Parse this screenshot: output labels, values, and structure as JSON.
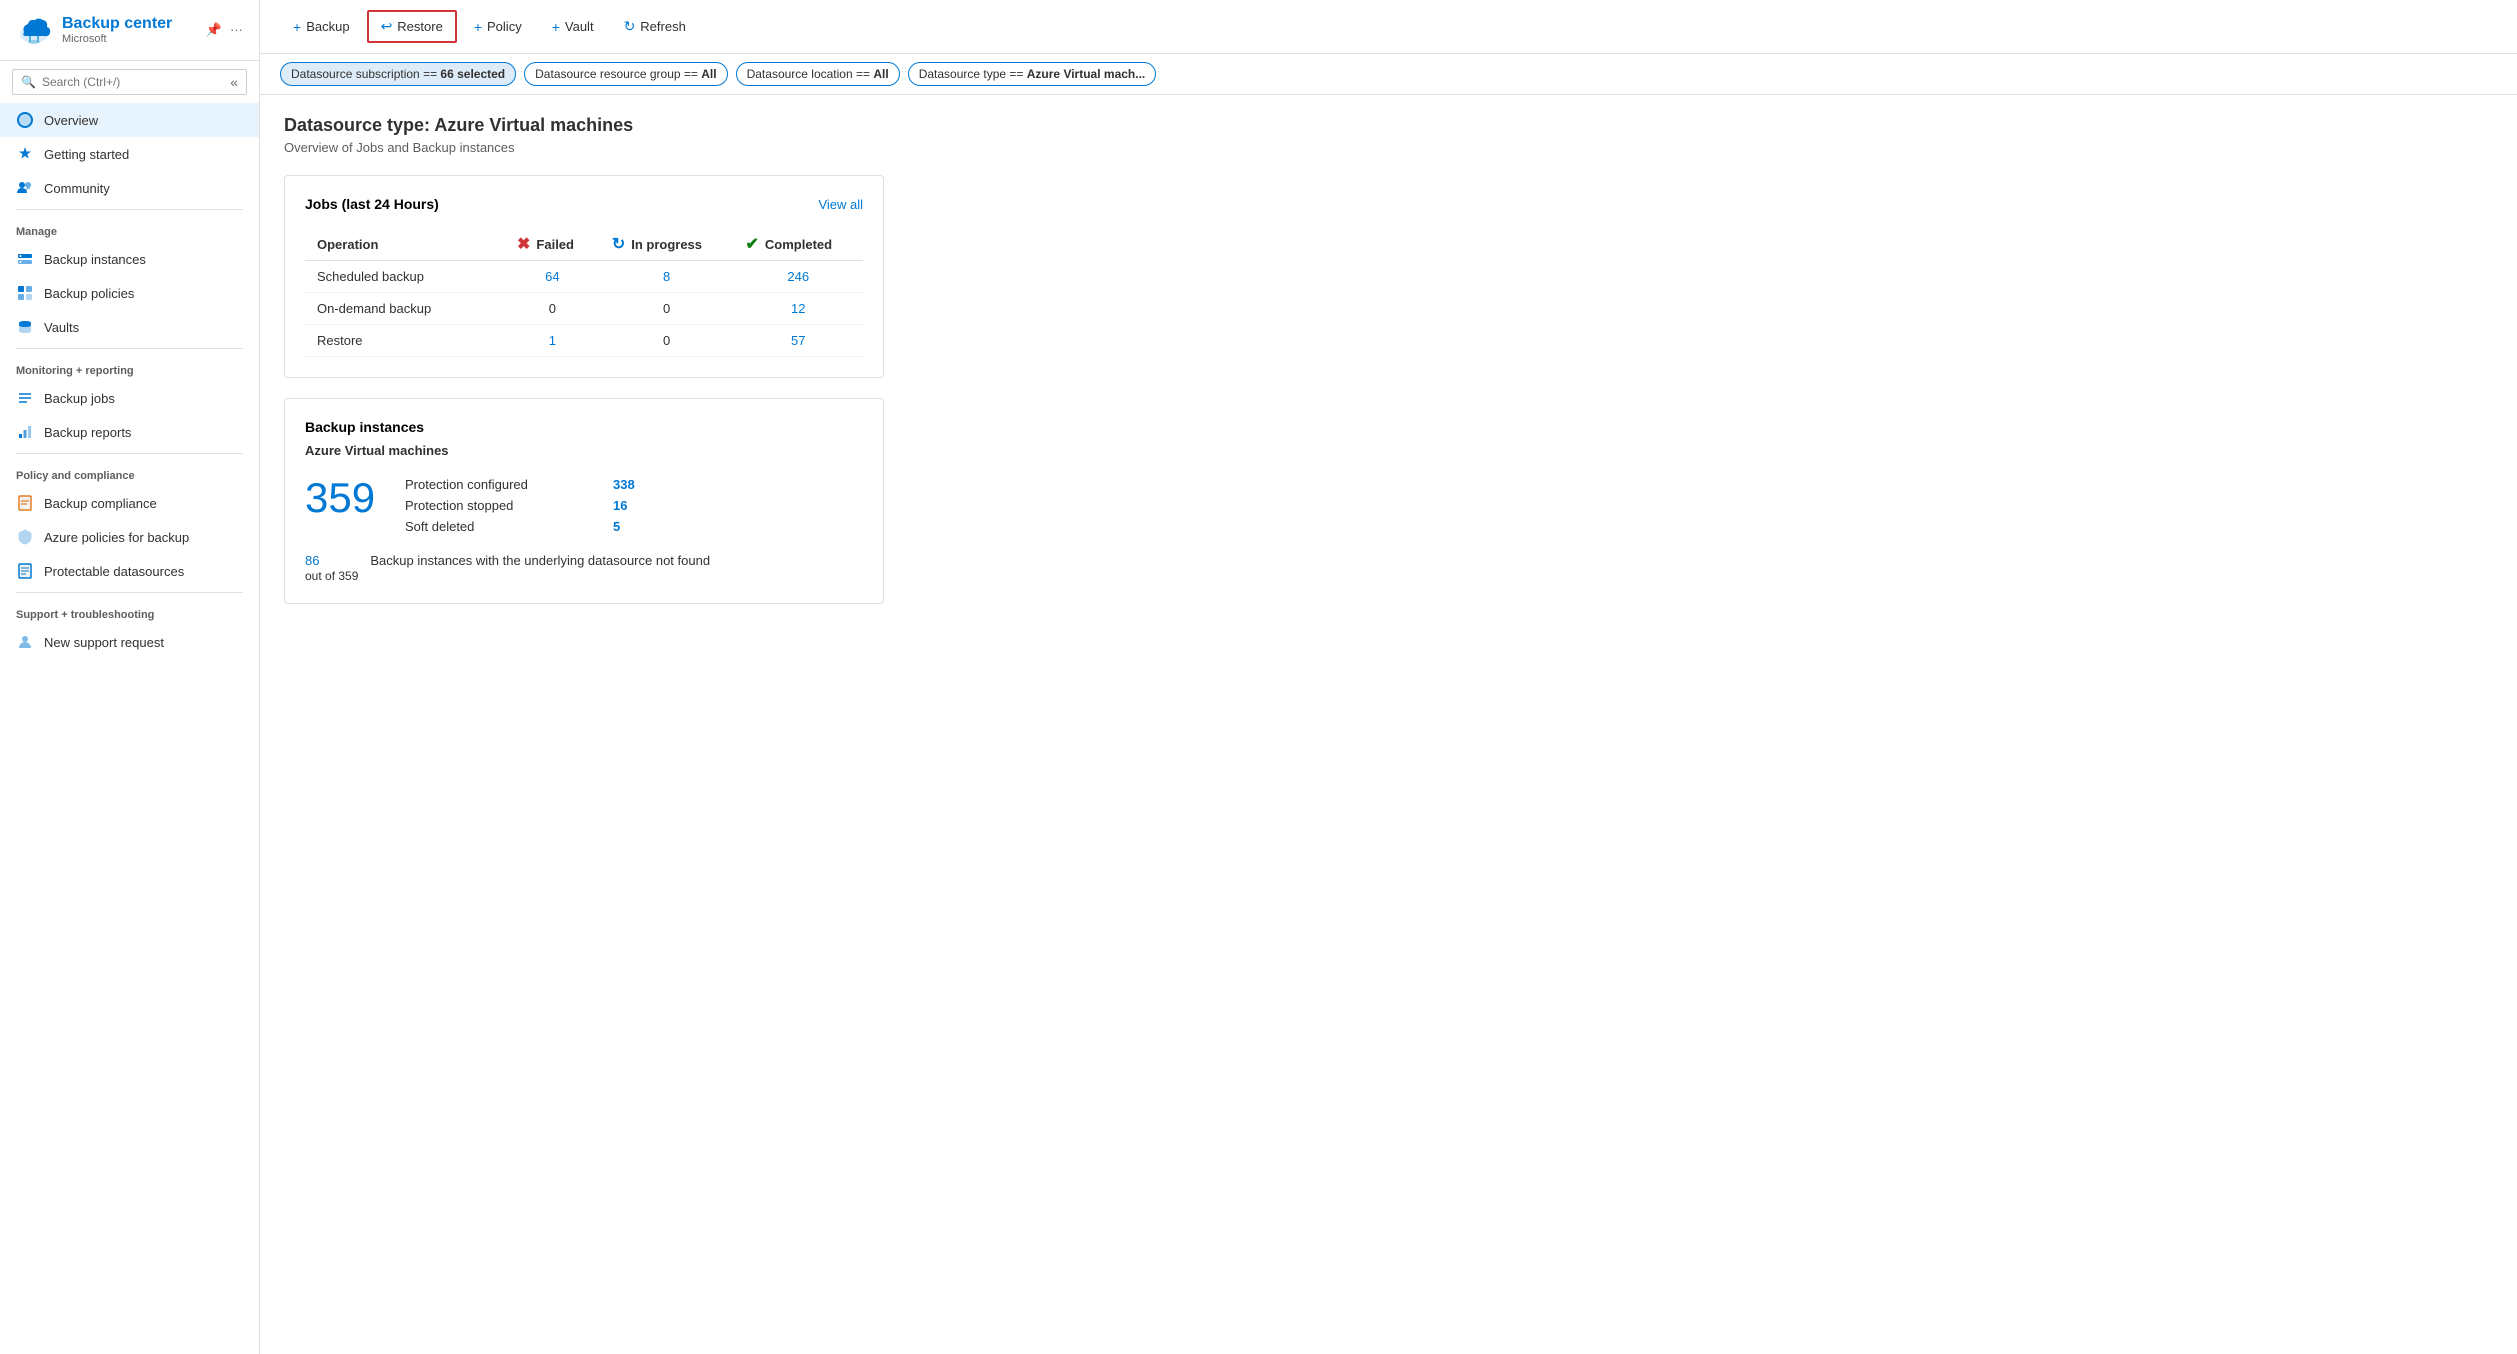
{
  "app": {
    "title": "Backup center",
    "subtitle": "Microsoft"
  },
  "sidebar": {
    "search_placeholder": "Search (Ctrl+/)",
    "nav_items": [
      {
        "id": "overview",
        "label": "Overview",
        "active": true,
        "icon": "cloud"
      },
      {
        "id": "getting-started",
        "label": "Getting started",
        "active": false,
        "icon": "rocket"
      },
      {
        "id": "community",
        "label": "Community",
        "active": false,
        "icon": "people"
      }
    ],
    "sections": [
      {
        "id": "manage",
        "label": "Manage",
        "items": [
          {
            "id": "backup-instances",
            "label": "Backup instances",
            "icon": "database"
          },
          {
            "id": "backup-policies",
            "label": "Backup policies",
            "icon": "grid"
          },
          {
            "id": "vaults",
            "label": "Vaults",
            "icon": "cloud-storage"
          }
        ]
      },
      {
        "id": "monitoring",
        "label": "Monitoring + reporting",
        "items": [
          {
            "id": "backup-jobs",
            "label": "Backup jobs",
            "icon": "list"
          },
          {
            "id": "backup-reports",
            "label": "Backup reports",
            "icon": "chart"
          }
        ]
      },
      {
        "id": "policy",
        "label": "Policy and compliance",
        "items": [
          {
            "id": "backup-compliance",
            "label": "Backup compliance",
            "icon": "doc-check"
          },
          {
            "id": "azure-policies",
            "label": "Azure policies for backup",
            "icon": "shield"
          },
          {
            "id": "protectable",
            "label": "Protectable datasources",
            "icon": "doc-list"
          }
        ]
      },
      {
        "id": "support",
        "label": "Support + troubleshooting",
        "items": [
          {
            "id": "new-support",
            "label": "New support request",
            "icon": "person"
          }
        ]
      }
    ]
  },
  "toolbar": {
    "buttons": [
      {
        "id": "backup",
        "label": "Backup",
        "icon": "+",
        "highlighted": false
      },
      {
        "id": "restore",
        "label": "Restore",
        "icon": "↩",
        "highlighted": true
      },
      {
        "id": "policy",
        "label": "Policy",
        "icon": "+",
        "highlighted": false
      },
      {
        "id": "vault",
        "label": "Vault",
        "icon": "+",
        "highlighted": false
      },
      {
        "id": "refresh",
        "label": "Refresh",
        "icon": "↻",
        "highlighted": false
      }
    ]
  },
  "filters": [
    {
      "id": "subscription",
      "label": "Datasource subscription == ",
      "bold": "66 selected",
      "selected": true
    },
    {
      "id": "resource-group",
      "label": "Datasource resource group == ",
      "bold": "All",
      "selected": false
    },
    {
      "id": "location",
      "label": "Datasource location == ",
      "bold": "All",
      "selected": false
    },
    {
      "id": "type",
      "label": "Datasource type == ",
      "bold": "Azure Virtual mach...",
      "selected": false
    }
  ],
  "main": {
    "title": "Datasource type: Azure Virtual machines",
    "subtitle": "Overview of Jobs and Backup instances"
  },
  "jobs_card": {
    "title": "Jobs (last 24 Hours)",
    "view_all": "View all",
    "columns": {
      "operation": "Operation",
      "failed": "Failed",
      "in_progress": "In progress",
      "completed": "Completed"
    },
    "rows": [
      {
        "operation": "Scheduled backup",
        "failed": "64",
        "failed_link": true,
        "in_progress": "8",
        "in_progress_link": true,
        "completed": "246",
        "completed_link": true
      },
      {
        "operation": "On-demand backup",
        "failed": "0",
        "failed_link": false,
        "in_progress": "0",
        "in_progress_link": false,
        "completed": "12",
        "completed_link": true
      },
      {
        "operation": "Restore",
        "failed": "1",
        "failed_link": true,
        "in_progress": "0",
        "in_progress_link": false,
        "completed": "57",
        "completed_link": true
      }
    ]
  },
  "backup_instances_card": {
    "title": "Backup instances",
    "subtitle": "Azure Virtual machines",
    "total_count": "359",
    "rows": [
      {
        "label": "Protection configured",
        "value": "338"
      },
      {
        "label": "Protection stopped",
        "value": "16"
      },
      {
        "label": "Soft deleted",
        "value": "5"
      }
    ],
    "footer_count": "86",
    "footer_out_of": "out of 359",
    "footer_label": "Backup instances with the underlying datasource not found"
  }
}
